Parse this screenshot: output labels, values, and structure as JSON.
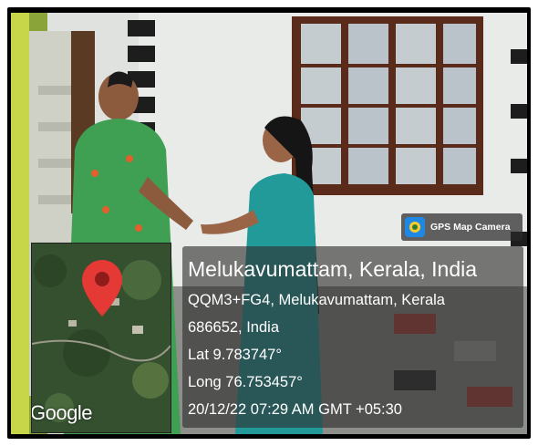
{
  "badge": {
    "label": "GPS Map Camera",
    "icon": "map-camera-icon"
  },
  "location": {
    "title": "Melukavumattam, Kerala, India",
    "address_line1": "QQM3+FG4, Melukavumattam, Kerala",
    "address_line2": "686652, India",
    "lat": "Lat 9.783747°",
    "long": "Long 76.753457°",
    "datetime": "20/12/22 07:29 AM GMT +05:30"
  },
  "map": {
    "watermark": "Google",
    "pin_icon": "map-pin-icon",
    "pin_color": "#e53935"
  }
}
